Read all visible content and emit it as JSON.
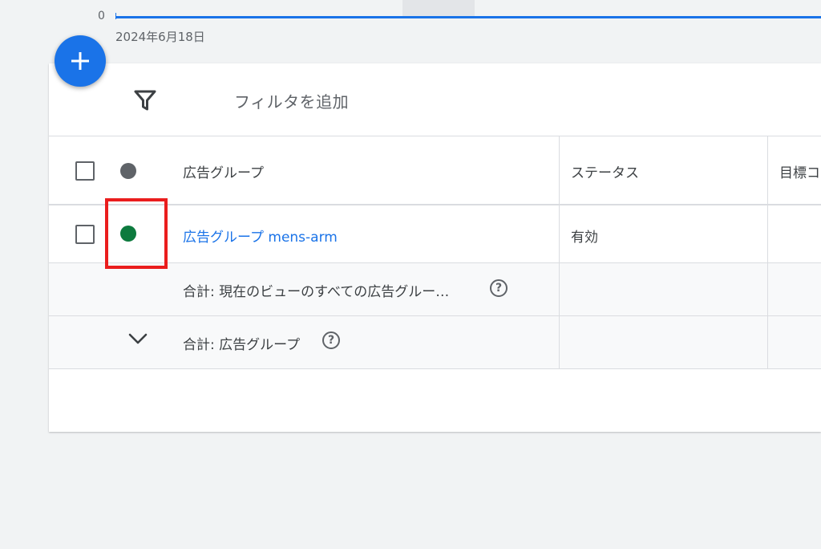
{
  "chart": {
    "zero_label": "0",
    "date_label": "2024年6月18日",
    "line_color": "#1a73e8"
  },
  "fab": {
    "icon": "plus-icon",
    "color": "#1a73e8"
  },
  "filter": {
    "icon": "funnel-icon",
    "label": "フィルタを追加"
  },
  "table": {
    "columns": {
      "name": "広告グループ",
      "status": "ステータス",
      "target": "目標コ"
    },
    "header_status_dot_color": "#5f6368",
    "rows": [
      {
        "name": "広告グループ mens-arm",
        "status": "有効",
        "status_dot_color": "#0d7a3e"
      }
    ],
    "totals": {
      "view_label": "合計: 現在のビューのすべての広告グルー…",
      "group_label": "合計: 広告グループ",
      "help_glyph": "?"
    }
  },
  "annotation": {
    "color": "#ea1d1d"
  }
}
